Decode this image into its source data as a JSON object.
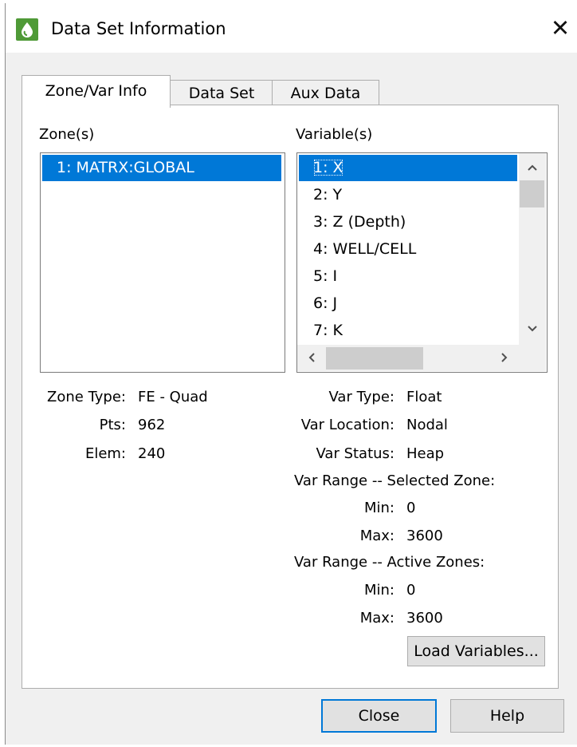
{
  "window": {
    "title": "Data Set Information",
    "close_glyph": "✕"
  },
  "tabs": [
    {
      "label": "Zone/Var Info"
    },
    {
      "label": "Data Set"
    },
    {
      "label": "Aux Data"
    }
  ],
  "zones": {
    "label": "Zone(s)",
    "items": [
      "1: MATRX:GLOBAL"
    ]
  },
  "variables": {
    "label": "Variable(s)",
    "items": [
      "1: X",
      "2: Y",
      "3: Z (Depth)",
      "4: WELL/CELL",
      "5: I",
      "6: J",
      "7: K"
    ]
  },
  "zone_info": {
    "type_label": "Zone Type:",
    "type_value": "FE - Quad",
    "pts_label": "Pts:",
    "pts_value": "962",
    "elem_label": "Elem:",
    "elem_value": "240"
  },
  "var_info": {
    "type_label": "Var Type:",
    "type_value": "Float",
    "location_label": "Var Location:",
    "location_value": "Nodal",
    "status_label": "Var Status:",
    "status_value": "Heap",
    "range_selected_label": "Var Range -- Selected Zone:",
    "sel_min_label": "Min:",
    "sel_min_value": "0",
    "sel_max_label": "Max:",
    "sel_max_value": "3600",
    "range_active_label": "Var Range -- Active Zones:",
    "act_min_label": "Min:",
    "act_min_value": "0",
    "act_max_label": "Max:",
    "act_max_value": "3600"
  },
  "buttons": {
    "load": "Load Variables...",
    "close": "Close",
    "help": "Help"
  },
  "icons": {
    "app": "tecplot-drop-icon",
    "scroll_up": "chevron-up-icon",
    "scroll_down": "chevron-down-icon",
    "scroll_left": "chevron-left-icon",
    "scroll_right": "chevron-right-icon"
  },
  "colors": {
    "selection": "#0078d7",
    "app_icon": "#4f9a37"
  }
}
